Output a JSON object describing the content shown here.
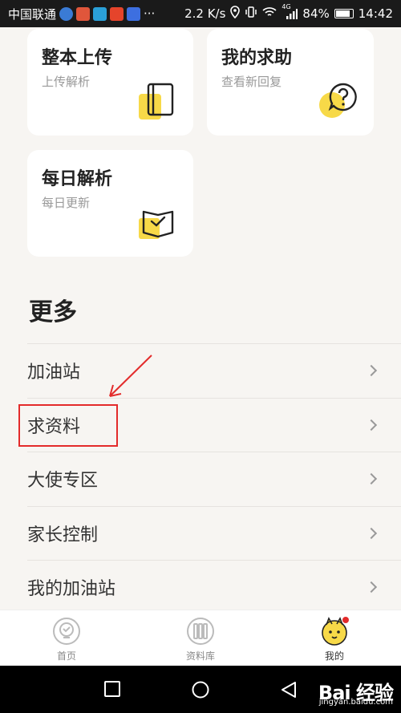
{
  "status_bar": {
    "carrier": "中国联通",
    "speed": "2.2 K/s",
    "signal_label": "4G",
    "battery": "84%",
    "time": "14:42",
    "more_glyph": "···"
  },
  "cards": [
    {
      "title": "整本上传",
      "subtitle": "上传解析",
      "icon": "book-upload-icon"
    },
    {
      "title": "我的求助",
      "subtitle": "查看新回复",
      "icon": "question-bubble-icon"
    },
    {
      "title": "每日解析",
      "subtitle": "每日更新",
      "icon": "open-book-check-icon"
    }
  ],
  "more": {
    "title": "更多",
    "items": [
      {
        "label": "加油站"
      },
      {
        "label": "求资料"
      },
      {
        "label": "大使专区"
      },
      {
        "label": "家长控制"
      },
      {
        "label": "我的加油站"
      }
    ]
  },
  "tab_bar": {
    "tabs": [
      {
        "label": "首页",
        "icon": "home-bulb-icon"
      },
      {
        "label": "资料库",
        "icon": "library-icon"
      },
      {
        "label": "我的",
        "icon": "avatar-icon"
      }
    ]
  },
  "watermark": {
    "main": "Bai 经验",
    "sub": "jingyan.baidu.com"
  },
  "colors": {
    "accent_yellow": "#f7d948",
    "annotation_red": "#e32b2b",
    "page_bg": "#f7f5f2"
  }
}
